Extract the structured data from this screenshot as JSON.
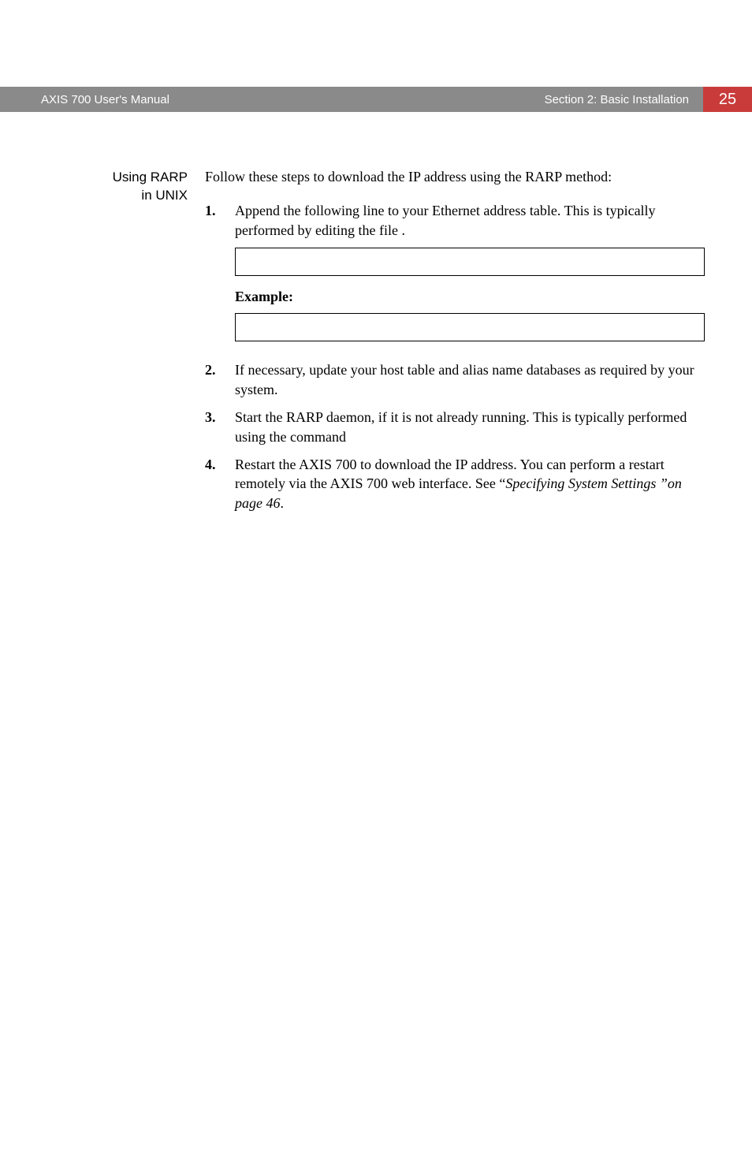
{
  "header": {
    "manual_title": "AXIS 700 User's Manual",
    "section_title": "Section 2: Basic Installation",
    "page_number": "25"
  },
  "sidebar": {
    "line1": "Using RARP",
    "line2": "in UNIX"
  },
  "intro": "Follow these steps to download the IP address using the RARP method:",
  "steps": {
    "s1": {
      "num": "1.",
      "text_a": "Append the following line to your Ethernet address table. This is typically performed by editing the file ",
      "text_b": "."
    },
    "example_label": "Example:",
    "s2": {
      "num": "2.",
      "text": "If necessary, update your host table and alias name databases as required by your system."
    },
    "s3": {
      "num": "3.",
      "text": "Start the RARP daemon, if it is not already running. This is typically performed using the command "
    },
    "s4": {
      "num": "4.",
      "text_a": "Restart the AXIS 700 to download the IP address. You can perform a restart remotely via the AXIS 700 web interface. See “",
      "text_b": "Specifying System Settings ”on page 46",
      "text_c": "."
    }
  }
}
